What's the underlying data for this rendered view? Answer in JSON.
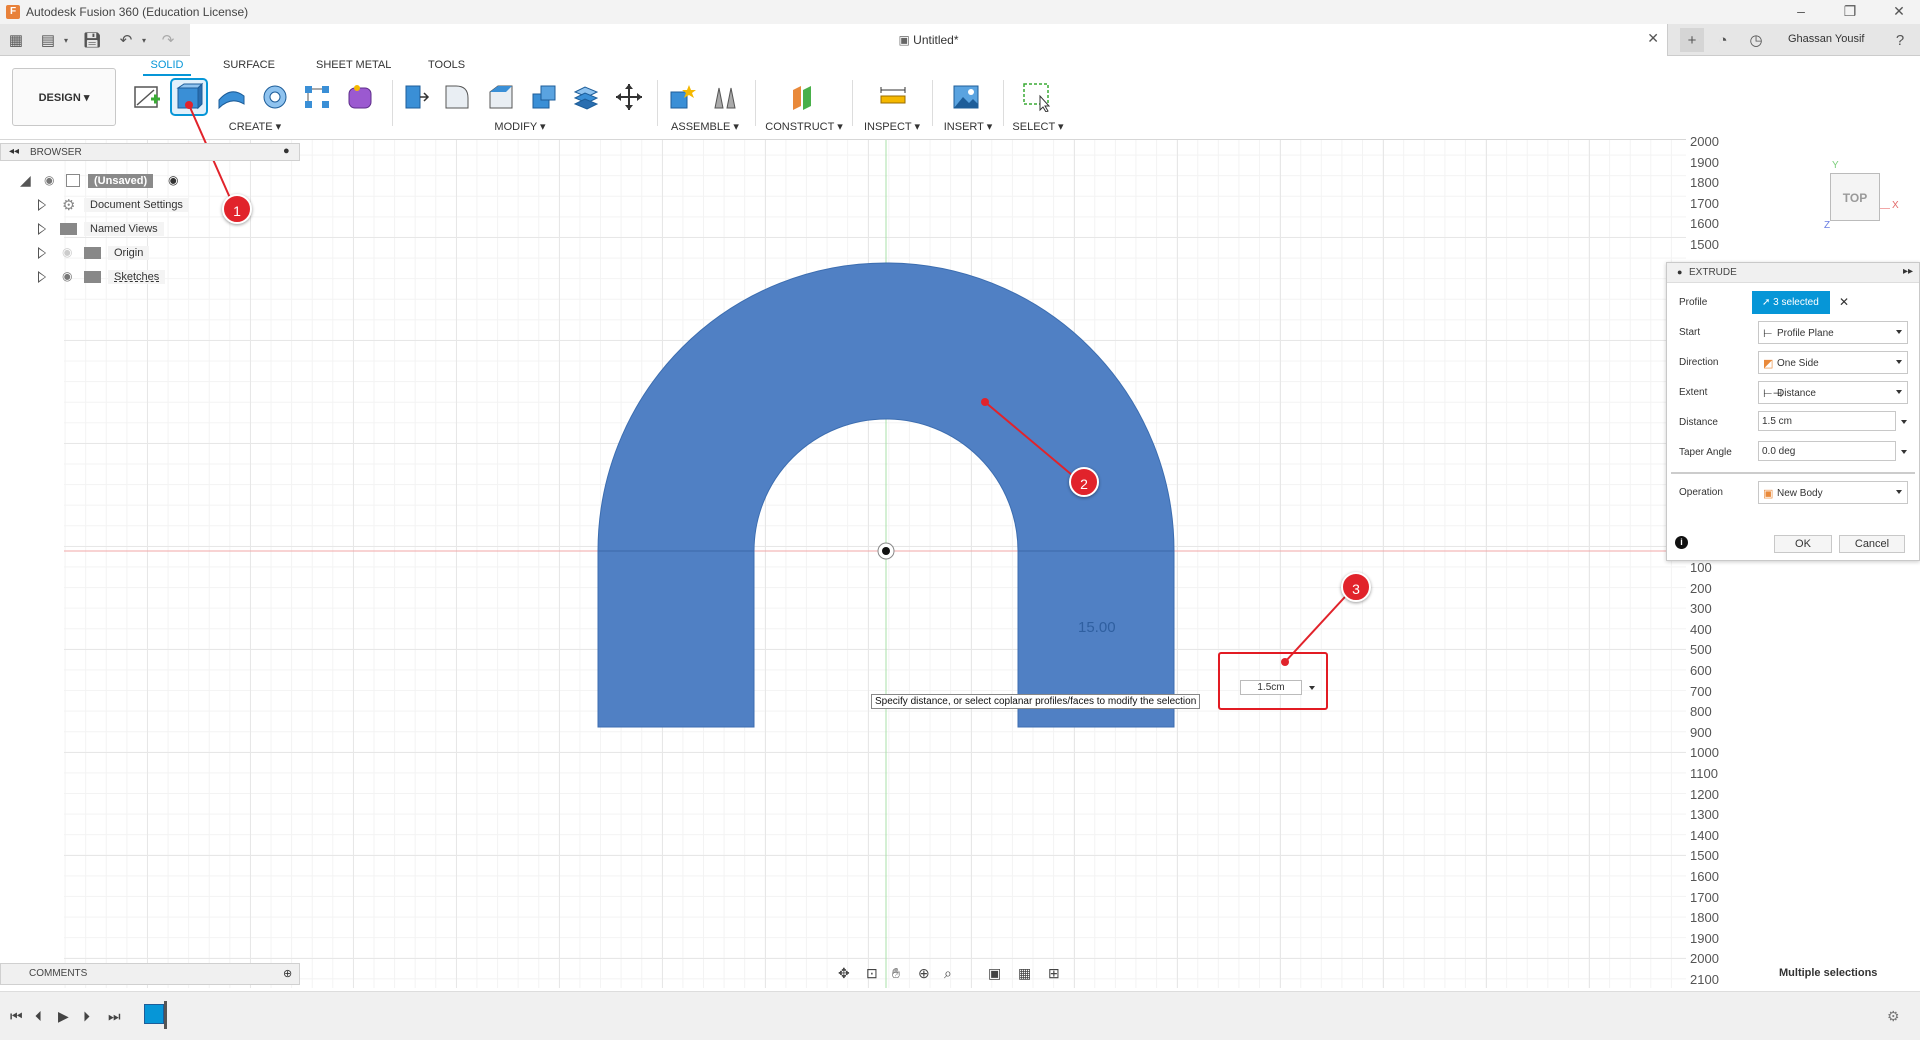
{
  "window": {
    "title": "Autodesk Fusion 360 (Education License)",
    "logo": "F"
  },
  "tabbar": {
    "document_title": "Untitled*",
    "user_name": "Ghassan Yousif"
  },
  "ribbon": {
    "workspace": "DESIGN ▾",
    "tabs": [
      "SOLID",
      "SURFACE",
      "SHEET METAL",
      "TOOLS"
    ],
    "groups": {
      "create": "CREATE ▾",
      "modify": "MODIFY ▾",
      "assemble": "ASSEMBLE ▾",
      "construct": "CONSTRUCT ▾",
      "inspect": "INSPECT ▾",
      "insert": "INSERT ▾",
      "select": "SELECT ▾"
    }
  },
  "browser": {
    "title": "BROWSER",
    "items": [
      {
        "label": "(Unsaved)"
      },
      {
        "label": "Document Settings"
      },
      {
        "label": "Named Views"
      },
      {
        "label": "Origin"
      },
      {
        "label": "Sketches"
      }
    ]
  },
  "viewcube": {
    "face": "TOP",
    "axis_x": "X",
    "axis_y": "Y",
    "axis_z": "Z"
  },
  "ruler": {
    "top": [
      "2000",
      "1900",
      "1800",
      "1700",
      "1600",
      "1500"
    ],
    "bottom": [
      "100",
      "200",
      "300",
      "400",
      "500",
      "600",
      "700",
      "800",
      "900",
      "1000",
      "1100",
      "1200",
      "1300",
      "1400",
      "1500",
      "1600",
      "1700",
      "1800",
      "1900",
      "2000",
      "2100"
    ]
  },
  "extrude": {
    "title": "EXTRUDE",
    "profile": {
      "label": "Profile",
      "value": "3 selected"
    },
    "start": {
      "label": "Start",
      "value": "Profile Plane"
    },
    "direction": {
      "label": "Direction",
      "value": "One Side"
    },
    "extent": {
      "label": "Extent",
      "value": "Distance"
    },
    "distance": {
      "label": "Distance",
      "value": "1.5 cm"
    },
    "taper": {
      "label": "Taper Angle",
      "value": "0.0 deg"
    },
    "operation": {
      "label": "Operation",
      "value": "New Body"
    },
    "ok": "OK",
    "cancel": "Cancel"
  },
  "canvas": {
    "dimension_text": "15.00",
    "tooltip": "Specify distance, or select coplanar profiles/faces to modify the selection",
    "distance_input": "1.5cm",
    "callouts": [
      "1",
      "2",
      "3"
    ],
    "body_color": "#5080c4"
  },
  "comments": {
    "title": "COMMENTS"
  },
  "status": {
    "text": "Multiple selections"
  },
  "colors": {
    "accent": "#0696d7",
    "callout": "#e1232b"
  }
}
